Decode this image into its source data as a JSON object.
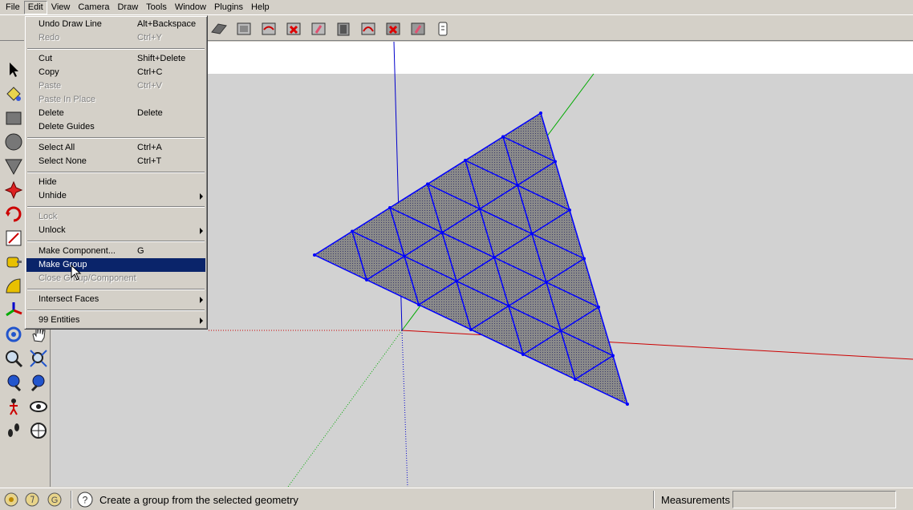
{
  "menubar": {
    "items": [
      "File",
      "Edit",
      "View",
      "Camera",
      "Draw",
      "Tools",
      "Window",
      "Plugins",
      "Help"
    ]
  },
  "edit_menu": {
    "items": [
      {
        "label": "Undo Draw Line",
        "shortcut": "Alt+Backspace",
        "enabled": true
      },
      {
        "label": "Redo",
        "shortcut": "Ctrl+Y",
        "enabled": false
      },
      {
        "sep": true
      },
      {
        "label": "Cut",
        "shortcut": "Shift+Delete",
        "enabled": true
      },
      {
        "label": "Copy",
        "shortcut": "Ctrl+C",
        "enabled": true
      },
      {
        "label": "Paste",
        "shortcut": "Ctrl+V",
        "enabled": false
      },
      {
        "label": "Paste In Place",
        "shortcut": "",
        "enabled": false
      },
      {
        "label": "Delete",
        "shortcut": "Delete",
        "enabled": true
      },
      {
        "label": "Delete Guides",
        "shortcut": "",
        "enabled": true
      },
      {
        "sep": true
      },
      {
        "label": "Select All",
        "shortcut": "Ctrl+A",
        "enabled": true
      },
      {
        "label": "Select None",
        "shortcut": "Ctrl+T",
        "enabled": true
      },
      {
        "sep": true
      },
      {
        "label": "Hide",
        "shortcut": "",
        "enabled": true
      },
      {
        "label": "Unhide",
        "shortcut": "",
        "enabled": true,
        "submenu": true
      },
      {
        "sep": true
      },
      {
        "label": "Lock",
        "shortcut": "",
        "enabled": false
      },
      {
        "label": "Unlock",
        "shortcut": "",
        "enabled": true,
        "submenu": true
      },
      {
        "sep": true
      },
      {
        "label": "Make Component...",
        "shortcut": "G",
        "enabled": true
      },
      {
        "label": "Make Group",
        "shortcut": "",
        "enabled": true,
        "highlighted": true
      },
      {
        "label": "Close Group/Component",
        "shortcut": "",
        "enabled": false
      },
      {
        "sep": true
      },
      {
        "label": "Intersect Faces",
        "shortcut": "",
        "enabled": true,
        "submenu": true
      },
      {
        "sep": true
      },
      {
        "label": "99 Entities",
        "shortcut": "",
        "enabled": true,
        "submenu": true
      }
    ]
  },
  "toolbar": {
    "icons": [
      "section-icon",
      "front-view-icon",
      "back-edge-icon",
      "select-red-icon",
      "paint-red-icon",
      "iso-view-icon",
      "curve-view-icon",
      "select-red-icon-2",
      "paint-red-icon-2",
      "scroll-icon"
    ]
  },
  "palette": {
    "icons": [
      "select-arrow-icon",
      "paint-bucket-icon",
      "rectangle-icon",
      "circle-icon",
      "polygon-icon",
      "push-pull-icon",
      "rotate-icon",
      "offset-icon",
      "tape-measure-icon",
      "protractor-icon",
      "axes-icon",
      "orbit-icon",
      "pan-hand-icon",
      "zoom-icon",
      "zoom-window-icon",
      "previous-view-icon",
      "next-view-icon",
      "walk-icon",
      "look-around-icon",
      "footprints-icon",
      "position-camera-icon"
    ]
  },
  "statusbar": {
    "message": "Create a group from the selected geometry",
    "measurements_label": "Measurements",
    "measurements_value": ""
  },
  "colors": {
    "selection_blue": "#0000ff",
    "face_gray": "#8c8c8c",
    "menu_highlight": "#0a246a",
    "x_axis": "#cc0000",
    "y_axis": "#00aa00",
    "z_axis": "#0000cc"
  }
}
